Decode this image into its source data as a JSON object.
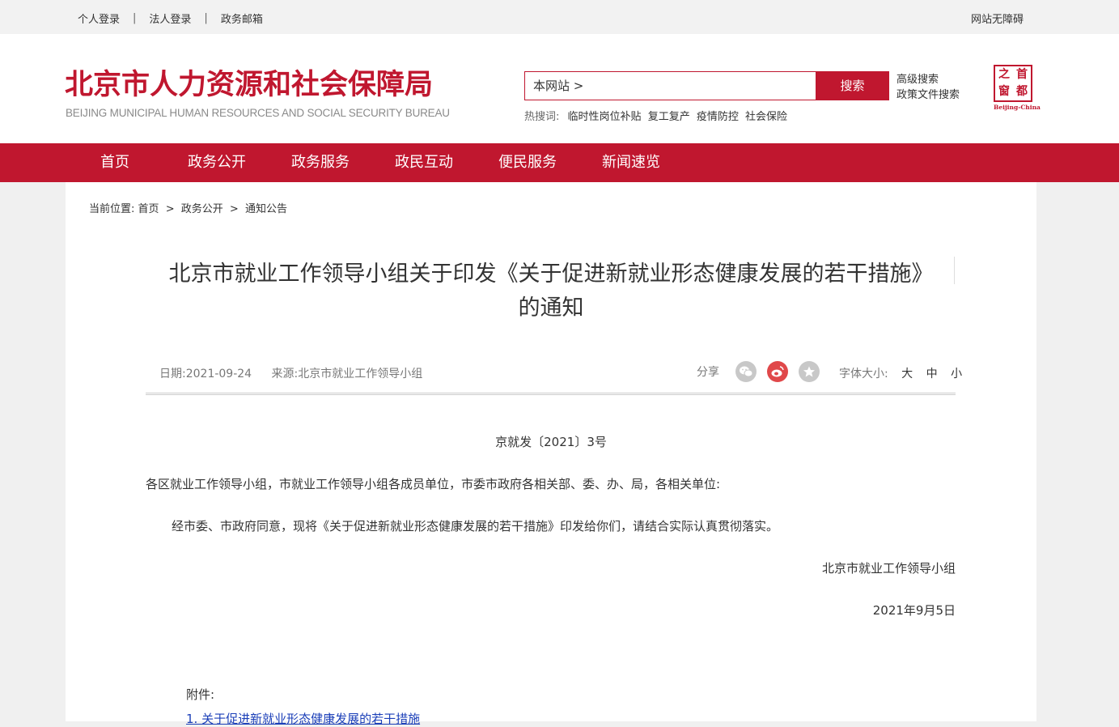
{
  "topbar": {
    "links": [
      "个人登录",
      "法人登录",
      "政务邮箱"
    ],
    "separator": "|",
    "accessibility": "网站无障碍"
  },
  "header": {
    "logo_cn": "北京市人力资源和社会保障局",
    "logo_en": "BEIJING MUNICIPAL HUMAN RESOURCES AND SOCIAL SECURITY BUREAU",
    "search": {
      "value": "本网站 >",
      "button": "搜索",
      "advanced": "高级搜索",
      "policy": "政策文件搜索",
      "hot_label": "热搜词:",
      "hot_words": [
        "临时性岗位补贴",
        "复工复产",
        "疫情防控",
        "社会保险"
      ]
    },
    "seal": {
      "chars": [
        "首",
        "都",
        "之",
        "窗"
      ],
      "en": "Beijing-China"
    }
  },
  "nav": {
    "items": [
      "首页",
      "政务公开",
      "政务服务",
      "政民互动",
      "便民服务",
      "新闻速览"
    ]
  },
  "breadcrumb": {
    "label": "当前位置:",
    "items": [
      "首页",
      "政务公开",
      "通知公告"
    ],
    "sep": ">"
  },
  "article": {
    "title_line1": "北京市就业工作领导小组关于印发《关于促进新就业形态健康发展的若干措施》",
    "title_line2": "的通知",
    "date": "日期:2021-09-24",
    "source": "来源:北京市就业工作领导小组",
    "share_label": "分享",
    "fontsize_label": "字体大小:",
    "fontsize_options": [
      "大",
      "中",
      "小"
    ],
    "doc_number": "京就发〔2021〕3号",
    "salutation": "各区就业工作领导小组，市就业工作领导小组各成员单位，市委市政府各相关部、委、办、局，各相关单位:",
    "body": "经市委、市政府同意，现将《关于促进新就业形态健康发展的若干措施》印发给你们，请结合实际认真贯彻落实。",
    "sign_org": "北京市就业工作领导小组",
    "sign_date": "2021年9月5日",
    "attachment_label": "附件:",
    "attachment_link": "1. 关于促进新就业形态健康发展的若干措施"
  },
  "colors": {
    "brand_red": "#c0172f",
    "link_blue": "#1b3fb8",
    "wechat_gray": "#c8c8c8",
    "weibo_red": "#e0484a",
    "favorite_gray": "#c8c8c8"
  }
}
